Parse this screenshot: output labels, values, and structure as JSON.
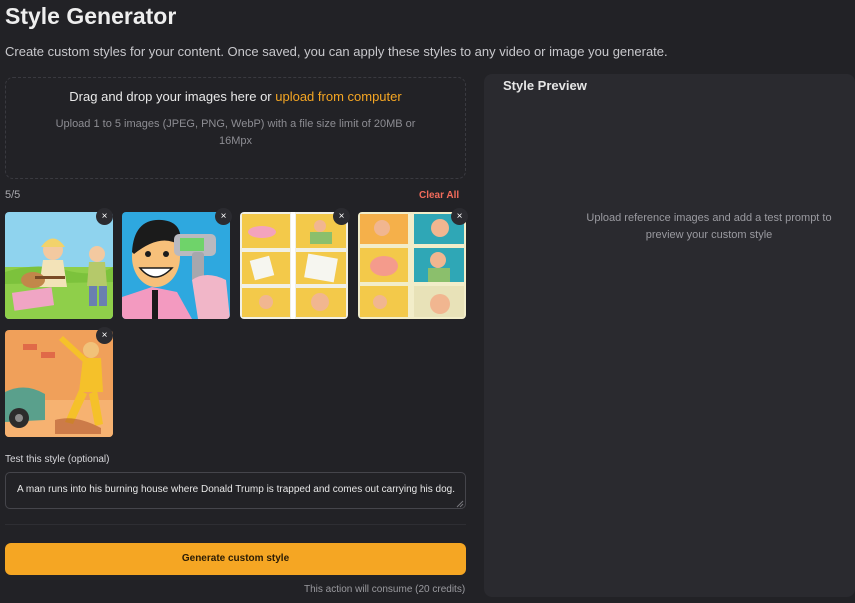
{
  "header": {
    "title": "Style Generator",
    "subtitle": "Create custom styles for your content. Once saved, you can apply these styles to any video or image you generate."
  },
  "upload": {
    "drag_text": "Drag and drop your images here or ",
    "link_text": "upload from computer",
    "hint": "Upload 1 to 5 images (JPEG, PNG, WebP) with a file size limit of 20MB or 16Mpx",
    "count": "5/5",
    "clear_all": "Clear All",
    "remove_symbol": "×"
  },
  "test_prompt": {
    "label": "Test this style (optional)",
    "value": "A man runs into his burning house where Donald Trump is trapped and comes out carrying his dog."
  },
  "actions": {
    "generate_label": "Generate custom style",
    "credits_note": "This action will consume (20 credits)"
  },
  "preview": {
    "title": "Style Preview",
    "empty_text": "Upload reference images and add a test prompt to preview your custom style"
  },
  "colors": {
    "background": "#222226",
    "accent": "#f5a623",
    "danger": "#f26b5b",
    "panel": "#2a2a2f"
  }
}
